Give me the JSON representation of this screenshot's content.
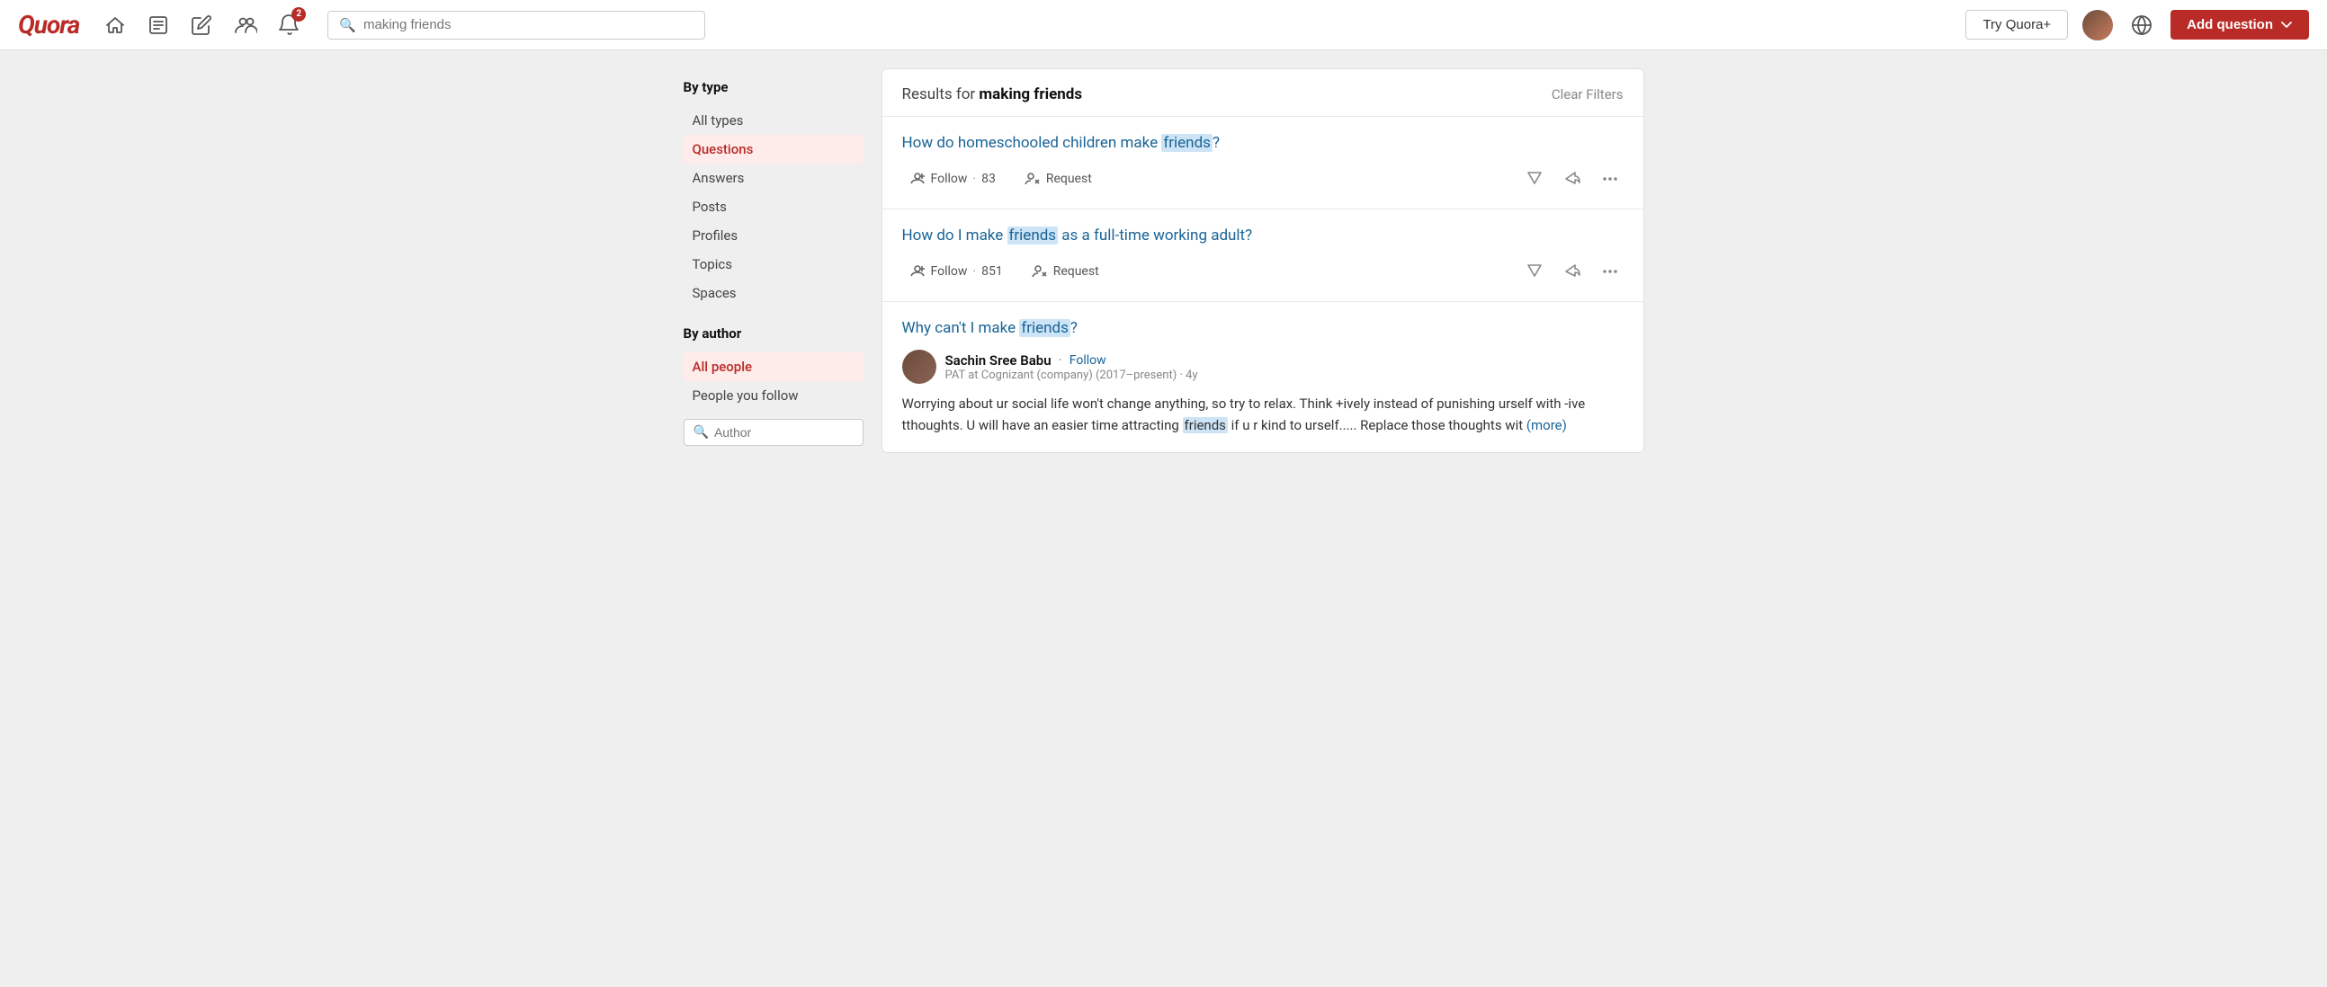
{
  "brand": {
    "logo": "Quora"
  },
  "navbar": {
    "search_placeholder": "making friends",
    "search_value": "making friends",
    "try_quora_label": "Try Quora+",
    "add_question_label": "Add question",
    "notification_count": "2"
  },
  "sidebar": {
    "by_type_heading": "By type",
    "by_author_heading": "By author",
    "type_items": [
      {
        "label": "All types",
        "id": "all-types",
        "active": false
      },
      {
        "label": "Questions",
        "id": "questions",
        "active": true
      },
      {
        "label": "Answers",
        "id": "answers",
        "active": false
      },
      {
        "label": "Posts",
        "id": "posts",
        "active": false
      },
      {
        "label": "Profiles",
        "id": "profiles",
        "active": false
      },
      {
        "label": "Topics",
        "id": "topics",
        "active": false
      },
      {
        "label": "Spaces",
        "id": "spaces",
        "active": false
      }
    ],
    "author_items": [
      {
        "label": "All people",
        "id": "all-people",
        "active": true
      },
      {
        "label": "People you follow",
        "id": "people-you-follow",
        "active": false
      }
    ],
    "author_search_placeholder": "Author"
  },
  "results": {
    "prefix": "Results for",
    "query": "making friends",
    "clear_filters": "Clear Filters",
    "items": [
      {
        "id": "q1",
        "type": "question",
        "title_before": "How do homeschooled children make ",
        "title_highlight": "friends",
        "title_after": "?",
        "follow_label": "Follow",
        "follow_count": "83",
        "request_label": "Request"
      },
      {
        "id": "q2",
        "type": "question",
        "title_before": "How do I make ",
        "title_highlight": "friends",
        "title_after": " as a full-time working adult?",
        "follow_label": "Follow",
        "follow_count": "851",
        "request_label": "Request"
      },
      {
        "id": "q3",
        "type": "answer",
        "title_before": "Why can't I make ",
        "title_highlight": "friends",
        "title_after": "?",
        "author_name": "Sachin Sree Babu",
        "author_follow": "Follow",
        "author_meta": "PAT at Cognizant (company) (2017–present) · 4y",
        "answer_text": "Worrying about ur social life won't change anything, so try to relax. Think +ively instead of punishing urself with -ive tthoughts. U will have an easier time attracting ",
        "answer_highlight": "friends",
        "answer_text_after": " if u r kind to urself..... Replace those thoughts wit",
        "answer_more": "(more)"
      }
    ]
  }
}
